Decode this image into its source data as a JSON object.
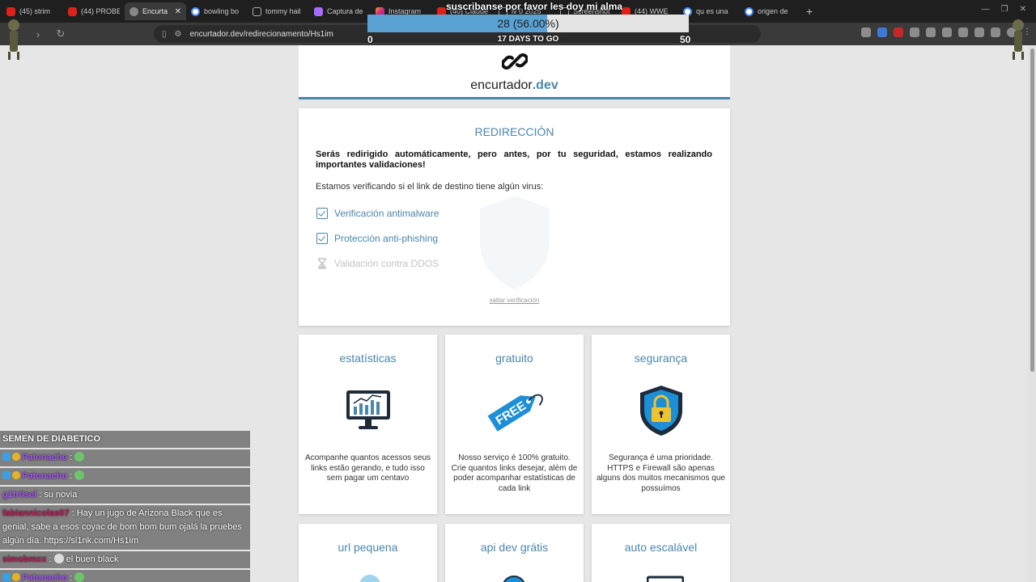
{
  "browser": {
    "tabs": [
      {
        "label": "(45) strim",
        "fav": "yt"
      },
      {
        "label": "(44) PROBE",
        "fav": "yt"
      },
      {
        "label": "Encurta",
        "fav": "enc",
        "active": true
      },
      {
        "label": "bowling bo",
        "fav": "gg"
      },
      {
        "label": "tommy hail",
        "fav": "doc"
      },
      {
        "label": "Captura de",
        "fav": "ap"
      },
      {
        "label": "Instagram",
        "fav": "ig"
      },
      {
        "label": "(40) Claude",
        "fav": "yt"
      },
      {
        "label": "lv 0 2025",
        "fav": "doc"
      },
      {
        "label": "Screenshot",
        "fav": "doc"
      },
      {
        "label": "(44) WWE",
        "fav": "yt"
      },
      {
        "label": "qu es una",
        "fav": "gg"
      },
      {
        "label": "origen de",
        "fav": "gg"
      }
    ],
    "new_tab": "+",
    "url": "encurtador.dev/redirecionamento/Hs1im"
  },
  "overlay": {
    "title": "suscribanse por favor les doy mi alma",
    "goal_label": "28 (56.00%)",
    "goal_fraction": 0.56,
    "goal_min": "0",
    "goal_max": "50",
    "days_left": "17 DAYS TO GO"
  },
  "site": {
    "brand_name": "encurtador",
    "brand_tld": ".dev"
  },
  "redirect": {
    "heading": "REDIRECCIÓN",
    "warning": "Serás redirigido automáticamente, pero antes, por tu seguridad, estamos realizando importantes validaciones!",
    "checking": "Estamos verificando si el link de destino tiene algún virus:",
    "checks": [
      {
        "label": "Verificación antimalware",
        "status": "done"
      },
      {
        "label": "Protección anti-phishing",
        "status": "done"
      },
      {
        "label": "Validación contra DDOS",
        "status": "pending"
      }
    ],
    "skip": "saltar verificación"
  },
  "features": [
    {
      "title": "estatísticas",
      "text": "Acompanhe quantos acessos seus links estão gerando, e tudo isso sem pagar um centavo",
      "icon": "monitor-chart-icon"
    },
    {
      "title": "gratuito",
      "text": "Nosso serviço é 100% gratuito. Crie quantos links desejar, além de poder acompanhar estatísticas de cada link",
      "icon": "free-tag-icon",
      "tag_text": "FREE"
    },
    {
      "title": "segurança",
      "text": "Segurança é uma prioridade. HTTPS e Firewall são apenas alguns dos muitos mecanismos que possuímos",
      "icon": "lock-shield-icon"
    },
    {
      "title": "url pequena",
      "text": "",
      "icon": "url-icon"
    },
    {
      "title": "api dev grátis",
      "text": "",
      "icon": "globe-icon"
    },
    {
      "title": "auto escalável",
      "text": "",
      "icon": "scale-icon"
    }
  ],
  "chat": {
    "title": "SEMEN DE DIABETICO",
    "messages": [
      {
        "user": "Patonacho",
        "text": "",
        "user_color": "#a855f7",
        "badges": true,
        "emote": "frog"
      },
      {
        "user": "Patonacho",
        "text": "",
        "user_color": "#a855f7",
        "badges": true,
        "emote": "frog2"
      },
      {
        "user": "g1tr0sel",
        "text": "su novia",
        "user_color": "#a855f7",
        "badges": false
      },
      {
        "user": "fabiannicolas07",
        "text": "Hay un jugo de Arizona Black que es genial, sabe a esos coyac de bom bom bum ojalá la pruebes algún día. https://sl1nk.com/Hs1im",
        "user_color": "#c2185b",
        "badges": false
      },
      {
        "user": "simobmxx",
        "text": "el buen black",
        "user_color": "#c2185b",
        "badges": false,
        "emote": "cat"
      },
      {
        "user": "Patonacho",
        "text": "",
        "user_color": "#a855f7",
        "badges": true,
        "emote": "frog"
      }
    ]
  },
  "colors": {
    "accent": "#4b86ad",
    "pending": "#c3c3c3",
    "goal_fill": "#5aa2d4"
  }
}
